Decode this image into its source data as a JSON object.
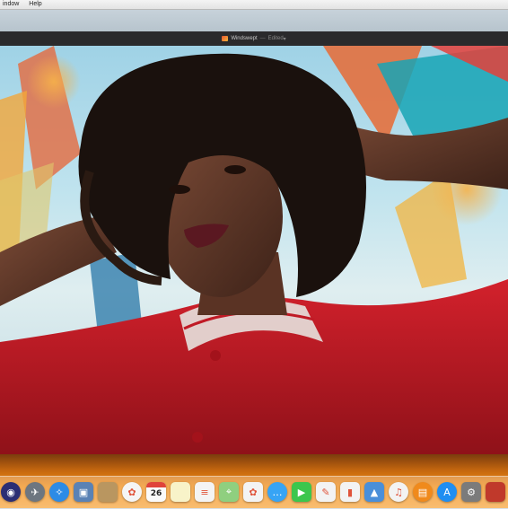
{
  "menubar": {
    "items": [
      "indow",
      "Help"
    ]
  },
  "window": {
    "title": "Windswept",
    "status": "Edited",
    "status_separator": "—"
  },
  "dock": {
    "calendar_day": "26",
    "icons": [
      {
        "name": "siri-icon",
        "glyph": "◉",
        "color": "#2b2e74"
      },
      {
        "name": "launchpad-icon",
        "glyph": "✈",
        "color": "#6d7680"
      },
      {
        "name": "safari-icon",
        "glyph": "✧",
        "color": "#2c8be6"
      },
      {
        "name": "preview-icon",
        "glyph": "▣",
        "color": "#5a82b5"
      },
      {
        "name": "notes-paper-icon",
        "glyph": "",
        "color": "#b99660"
      },
      {
        "name": "photos-icon",
        "glyph": "✿",
        "color": "#f5f5f5"
      },
      {
        "name": "calendar-icon",
        "glyph": "",
        "color": "#fafafa"
      },
      {
        "name": "notes-icon",
        "glyph": "",
        "color": "#f8f3c9"
      },
      {
        "name": "reminders-icon",
        "glyph": "≡",
        "color": "#f4f4f4"
      },
      {
        "name": "maps-icon",
        "glyph": "⌖",
        "color": "#8fcf7f"
      },
      {
        "name": "photos-booth-icon",
        "glyph": "✿",
        "color": "#f3f3f3"
      },
      {
        "name": "messages-icon",
        "glyph": "…",
        "color": "#37a4f5"
      },
      {
        "name": "facetime-icon",
        "glyph": "▶",
        "color": "#3cc64d"
      },
      {
        "name": "pages-icon",
        "glyph": "✎",
        "color": "#f3f3f3"
      },
      {
        "name": "numbers-icon",
        "glyph": "▮",
        "color": "#f3f3f3"
      },
      {
        "name": "keynote-icon",
        "glyph": "▲",
        "color": "#4a8fd9"
      },
      {
        "name": "itunes-icon",
        "glyph": "♫",
        "color": "#f3f3f3"
      },
      {
        "name": "ibooks-icon",
        "glyph": "▤",
        "color": "#f08a1c"
      },
      {
        "name": "app-store-icon",
        "glyph": "A",
        "color": "#1f8ef1"
      },
      {
        "name": "system-preferences-icon",
        "glyph": "⚙",
        "color": "#7b7b7b"
      },
      {
        "name": "photo-thumbnail-icon",
        "glyph": "",
        "color": "#c0392b"
      }
    ]
  }
}
